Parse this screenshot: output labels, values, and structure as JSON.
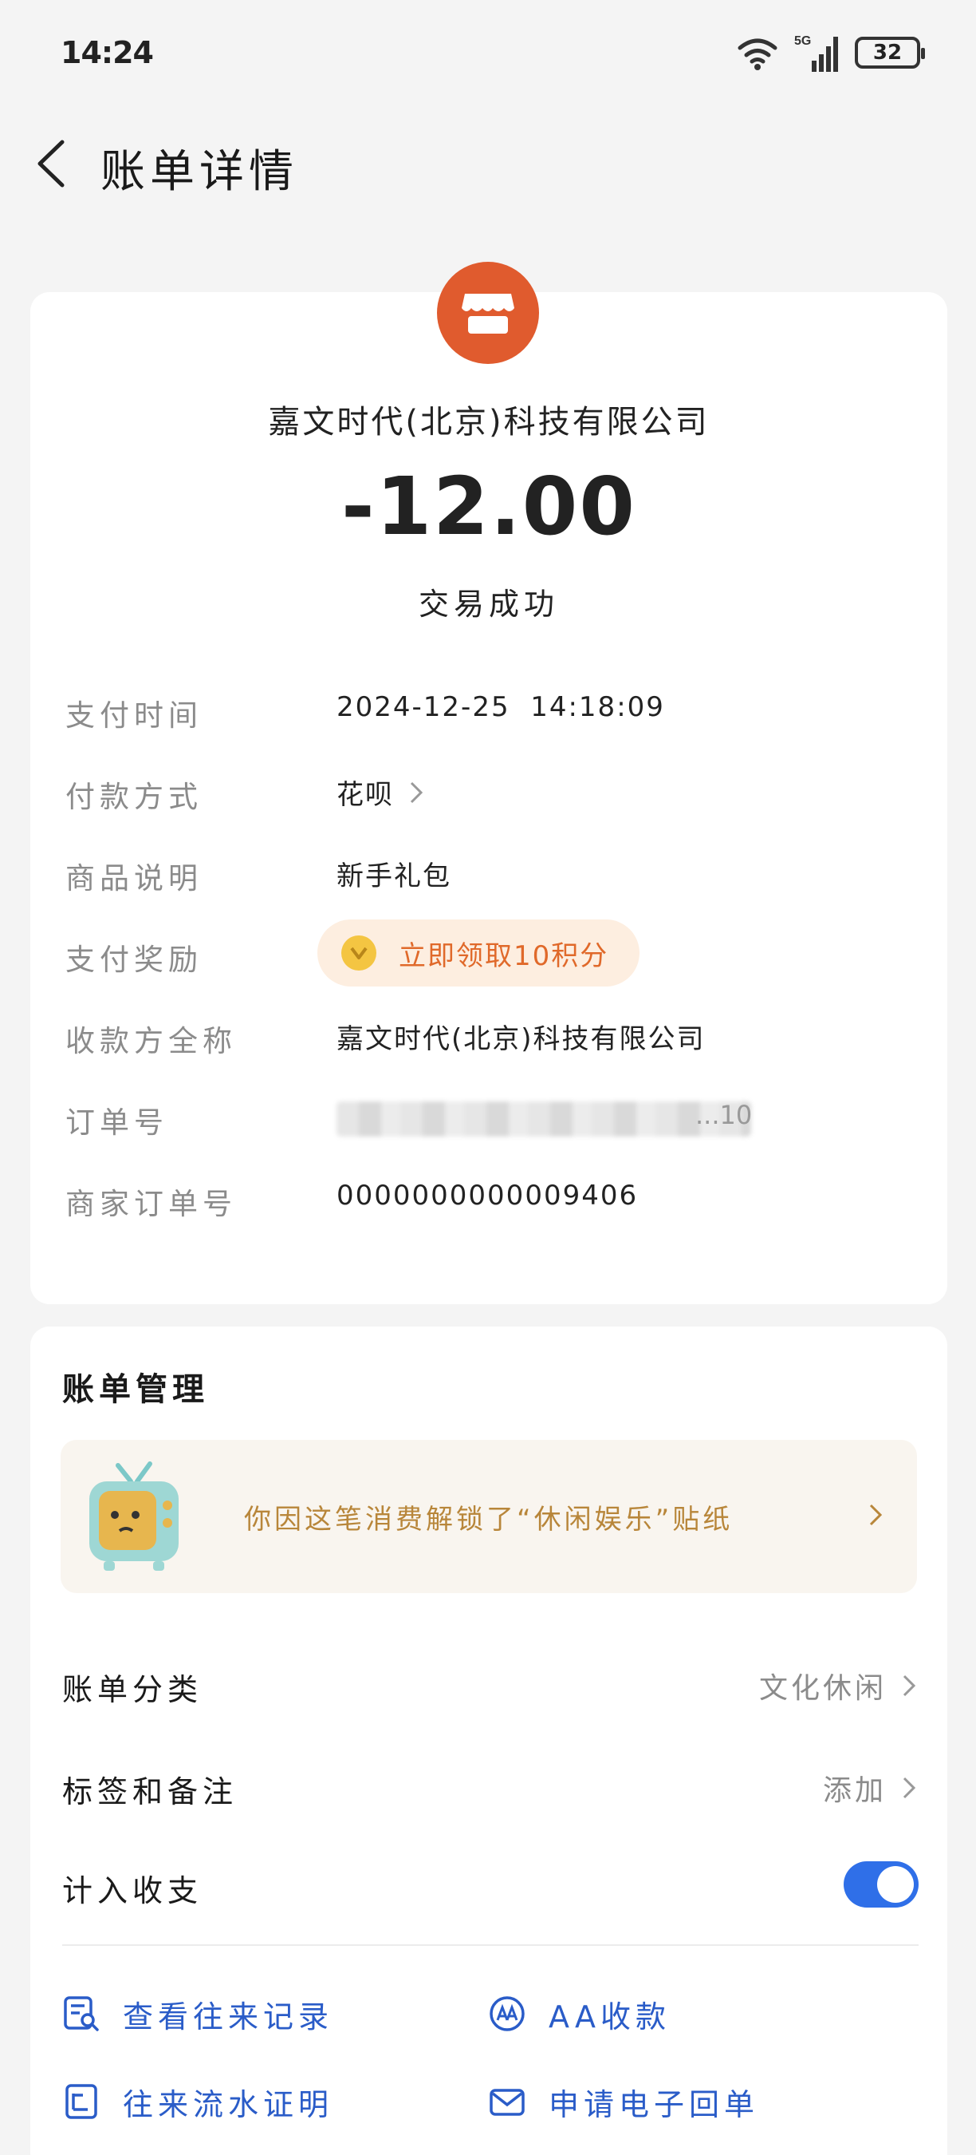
{
  "status_bar": {
    "time": "14:24",
    "battery": "32",
    "network": "5G"
  },
  "header": {
    "title": "账单详情"
  },
  "bill": {
    "merchant_name": "嘉文时代(北京)科技有限公司",
    "amount": "-12.00",
    "status": "交易成功",
    "rows": {
      "pay_time": {
        "label": "支付时间",
        "value": "2024-12-25  14:18:09"
      },
      "pay_method": {
        "label": "付款方式",
        "value": "花呗"
      },
      "product": {
        "label": "商品说明",
        "value": "新手礼包"
      },
      "reward": {
        "label": "支付奖励",
        "value": "立即领取10积分"
      },
      "payee": {
        "label": "收款方全称",
        "value": "嘉文时代(北京)科技有限公司"
      },
      "order_no": {
        "label": "订单号",
        "value_tail": "...10"
      },
      "merchant_order": {
        "label": "商家订单号",
        "value": "0000000000009406"
      }
    }
  },
  "manage": {
    "title": "账单管理",
    "sticker_text": "你因这笔消费解锁了“休闲娱乐”贴纸",
    "category": {
      "label": "账单分类",
      "value": "文化休闲"
    },
    "tags": {
      "label": "标签和备注",
      "value": "添加"
    },
    "include": {
      "label": "计入收支",
      "enabled": true
    },
    "actions": {
      "history": "查看往来记录",
      "aa": "AA收款",
      "proof": "往来流水证明",
      "receipt": "申请电子回单"
    }
  },
  "colors": {
    "accent": "#2f6fe8",
    "merchant_logo": "#e05b2e",
    "reward": "#e0692a",
    "sticker_text": "#b8863a"
  }
}
